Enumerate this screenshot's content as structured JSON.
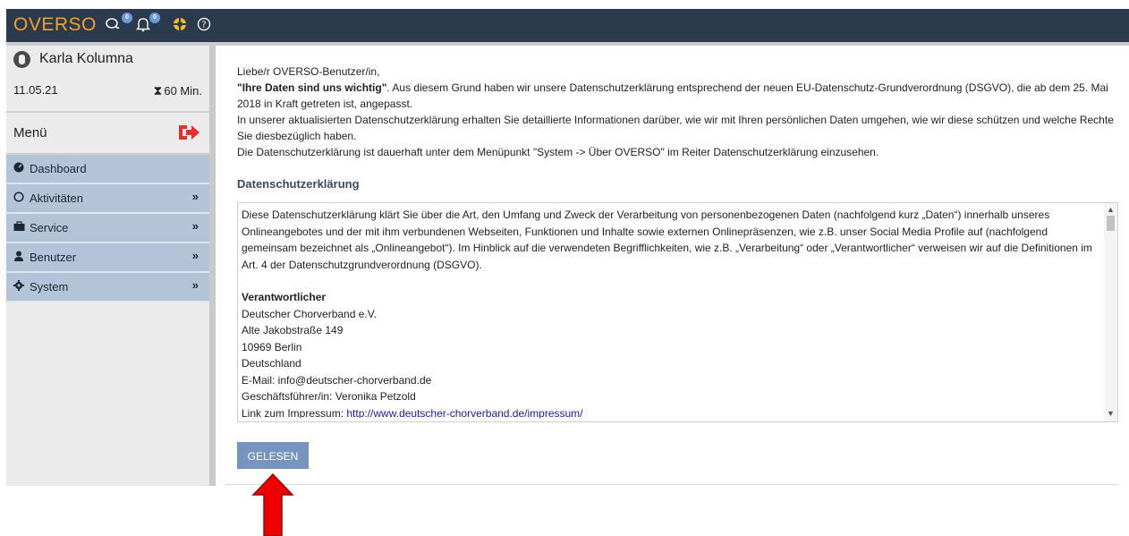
{
  "topbar": {
    "logo": "OVERSO",
    "icons": [
      {
        "name": "chat-icon",
        "glyph": "⚯",
        "badge": "0"
      },
      {
        "name": "bell-icon",
        "glyph": "🔔",
        "badge": "0"
      },
      {
        "name": "lifebuoy-icon",
        "glyph": "⊕"
      },
      {
        "name": "help-icon",
        "glyph": "?"
      }
    ],
    "accent_color": "#f4a02a",
    "bg_color": "#2b3a4d"
  },
  "sidebar": {
    "user_name": "Karla Kolumna",
    "date": "11.05.21",
    "timer": "60 Min.",
    "menu_label": "Menü",
    "items": [
      {
        "label": "Dashboard",
        "icon": "tachometer-icon",
        "has_chevron": false
      },
      {
        "label": "Aktivitäten",
        "icon": "circle-icon",
        "has_chevron": true
      },
      {
        "label": "Service",
        "icon": "briefcase-icon",
        "has_chevron": true
      },
      {
        "label": "Benutzer",
        "icon": "user-icon",
        "has_chevron": true
      },
      {
        "label": "System",
        "icon": "gear-icon",
        "has_chevron": true
      }
    ]
  },
  "main": {
    "greeting": "Liebe/r OVERSO-Benutzer/in,",
    "intro_bold": "\"Ihre Daten sind uns wichtig\"",
    "intro_rest": ". Aus diesem Grund haben wir unsere Datenschutzerklärung entsprechend der neuen EU-Datenschutz-Grundverordnung (DSGVO), die ab dem 25. Mai 2018 in Kraft getreten ist, angepasst.",
    "intro_p2": "In unserer aktualisierten Datenschutzerklärung erhalten Sie detaillierte Informationen darüber, wie wir mit Ihren persönlichen Daten umgehen, wie wir diese schützen und welche Rechte Sie diesbezüglich haben.",
    "intro_p3": "Die Datenschutzerklärung ist dauerhaft unter dem Menüpunkt \"System -> Über OVERSO\" im Reiter Datenschutzerklärung einzusehen.",
    "section_heading": "Datenschutzerklärung",
    "policy_intro": "Diese Datenschutzerklärung klärt Sie über die Art, den Umfang und Zweck der Verarbeitung von personenbezogenen Daten (nachfolgend kurz „Daten“) innerhalb unseres Onlineangebotes und der mit ihm verbundenen Webseiten, Funktionen und Inhalte sowie externen Onlinepräsenzen, wie z.B. unser Social Media Profile auf (nachfolgend gemeinsam bezeichnet als „Onlineangebot“). Im Hinblick auf die verwendeten Begrifflichkeiten, wie z.B. „Verarbeitung“ oder „Verantwortlicher“ verweisen wir auf die Definitionen im Art. 4 der Datenschutzgrundverordnung (DSGVO).",
    "responsible_heading": "Verantwortlicher",
    "address_lines": [
      "Deutscher Chorverband e.V.",
      "Alte Jakobstraße 149",
      "10969 Berlin",
      "Deutschland",
      "E-Mail: info@deutscher-chorverband.de",
      "Geschäftsführer/in: Veronika Petzold"
    ],
    "impressum_label": "Link zum Impressum: ",
    "impressum_link": "http://www.deutscher-chorverband.de/impressum/",
    "button_label": "GELESEN"
  },
  "annotation": {
    "arrow_color": "#ee0000"
  }
}
